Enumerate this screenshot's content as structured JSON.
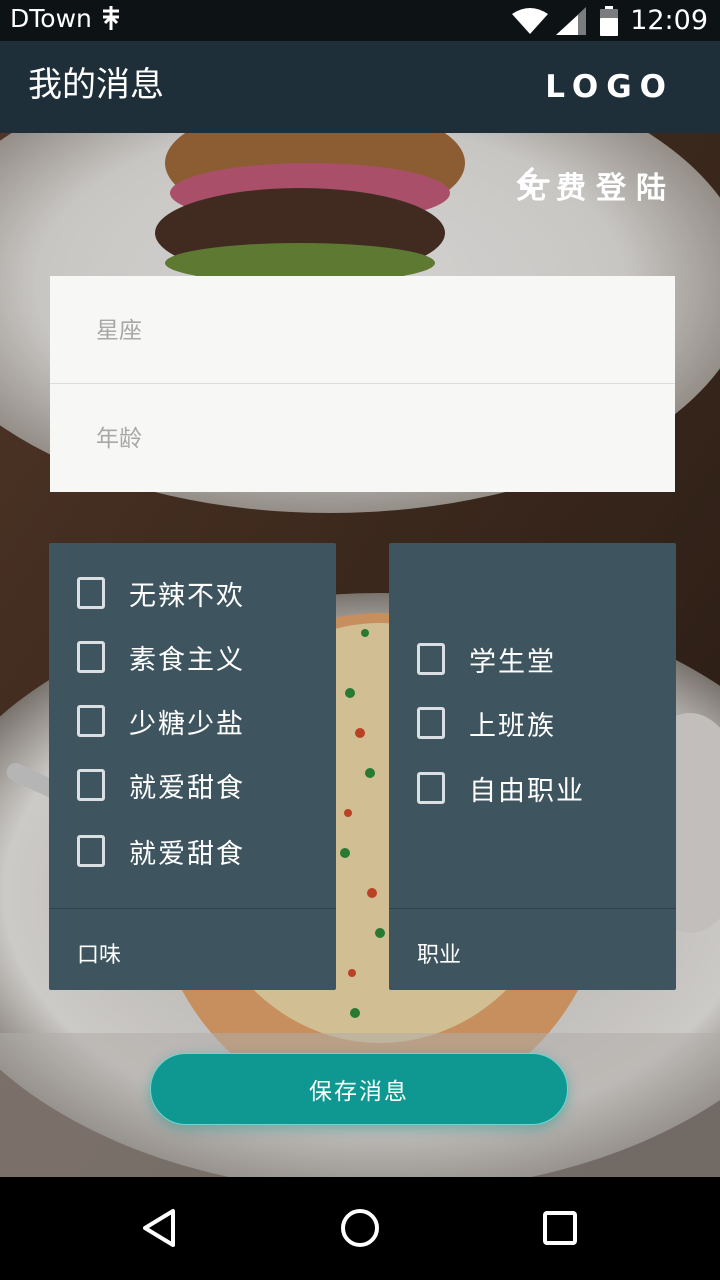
{
  "status_bar": {
    "carrier": "DTown",
    "time": "12:09"
  },
  "app_bar": {
    "title": "我的消息",
    "logo": "LOGO"
  },
  "login": {
    "label": "免费登陆"
  },
  "form": {
    "constellation_placeholder": "星座",
    "age_placeholder": "年龄"
  },
  "taste_panel": {
    "items": [
      "无辣不欢",
      "素食主义",
      "少糖少盐",
      "就爱甜食",
      "就爱甜食"
    ],
    "footer": "口味"
  },
  "job_panel": {
    "items": [
      "学生堂",
      "上班族",
      "自由职业"
    ],
    "footer": "职业"
  },
  "save_button": {
    "label": "保存消息"
  },
  "colors": {
    "app_bar": "#1f2f39",
    "panel": "#3e555f",
    "accent": "#0f9891"
  },
  "icons": {
    "carrier_icon": "sim-icon",
    "wifi": "wifi-icon",
    "signal": "signal-icon",
    "battery": "battery-icon",
    "login_arrow": "arrow-left-icon",
    "nav_back": "back-triangle-icon",
    "nav_home": "home-circle-icon",
    "nav_recent": "recent-square-icon"
  }
}
